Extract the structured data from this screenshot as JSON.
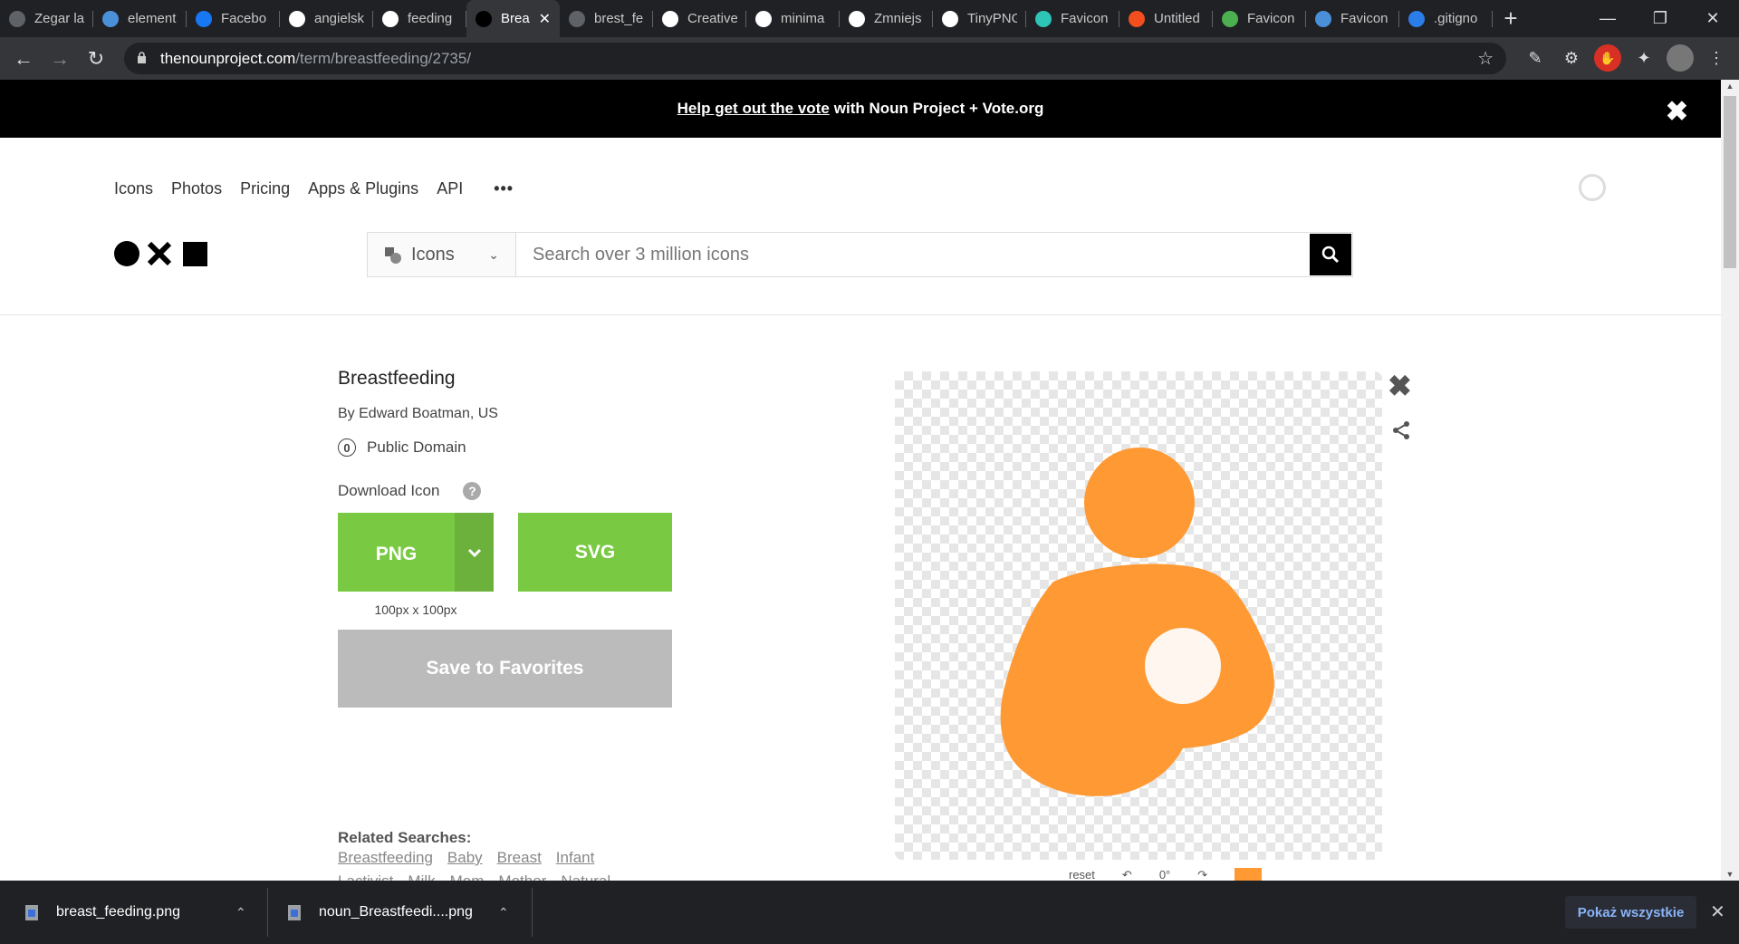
{
  "browser": {
    "tabs": [
      {
        "label": "Zegar la",
        "fav_color": "#5f6368",
        "icon": "globe-icon"
      },
      {
        "label": "element",
        "fav_color": "#4a90d9",
        "icon": "noun-project-icon"
      },
      {
        "label": "Facebo",
        "fav_color": "#1877f2",
        "icon": "facebook-icon"
      },
      {
        "label": "angielsk",
        "fav_color": "#ffffff",
        "icon": "google-icon"
      },
      {
        "label": "feeding",
        "fav_color": "#ffffff",
        "icon": "google-icon"
      },
      {
        "label": "Brea",
        "fav_color": "#000000",
        "icon": "noun-project-icon",
        "active": true
      },
      {
        "label": "brest_fe",
        "fav_color": "#5f6368",
        "icon": "globe-icon"
      },
      {
        "label": "Creative",
        "fav_color": "#ffffff",
        "icon": "creative-commons-icon"
      },
      {
        "label": "minima",
        "fav_color": "#ffffff",
        "icon": "google-icon"
      },
      {
        "label": "Zmniejs",
        "fav_color": "#ffffff",
        "icon": "trello-icon"
      },
      {
        "label": "TinyPNG",
        "fav_color": "#ffffff",
        "icon": "tinypng-icon"
      },
      {
        "label": "Favicon",
        "fav_color": "#2ec4b6",
        "icon": "favicon-icon"
      },
      {
        "label": "Untitled",
        "fav_color": "#f24e1e",
        "icon": "figma-icon"
      },
      {
        "label": "Favicon",
        "fav_color": "#4caf50",
        "icon": "check-icon"
      },
      {
        "label": "Favicon",
        "fav_color": "#4a90d9",
        "icon": "noun-project-icon"
      },
      {
        "label": ".gitigno",
        "fav_color": "#2b7de9",
        "icon": "gitignore-icon"
      }
    ],
    "url_host": "thenounproject.com",
    "url_path": "/term/breastfeeding/2735/"
  },
  "banner": {
    "link": "Help get out the vote",
    "text": "with Noun Project + Vote.org"
  },
  "nav": {
    "items": [
      "Icons",
      "Photos",
      "Pricing",
      "Apps & Plugins",
      "API"
    ],
    "more": "•••"
  },
  "search": {
    "category": "Icons",
    "placeholder": "Search over 3 million icons"
  },
  "icon": {
    "title": "Breastfeeding",
    "author": "By Edward Boatman, US",
    "license": "Public Domain",
    "license_glyph": "0",
    "download_label": "Download Icon",
    "help": "?",
    "png": "PNG",
    "svg": "SVG",
    "size": "100px x 100px",
    "favorites": "Save to Favorites",
    "color": "#ff9933"
  },
  "related": {
    "title": "Related Searches:",
    "tags": [
      "Breastfeeding",
      "Baby",
      "Breast",
      "Infant",
      "Lactivist",
      "Milk",
      "Mom",
      "Mother",
      "Natural"
    ]
  },
  "editbar": {
    "reset": "reset",
    "rotation": "0°"
  },
  "downloads": {
    "items": [
      "breast_feeding.png",
      "noun_Breastfeedi....png"
    ],
    "show_all": "Pokaż wszystkie"
  }
}
